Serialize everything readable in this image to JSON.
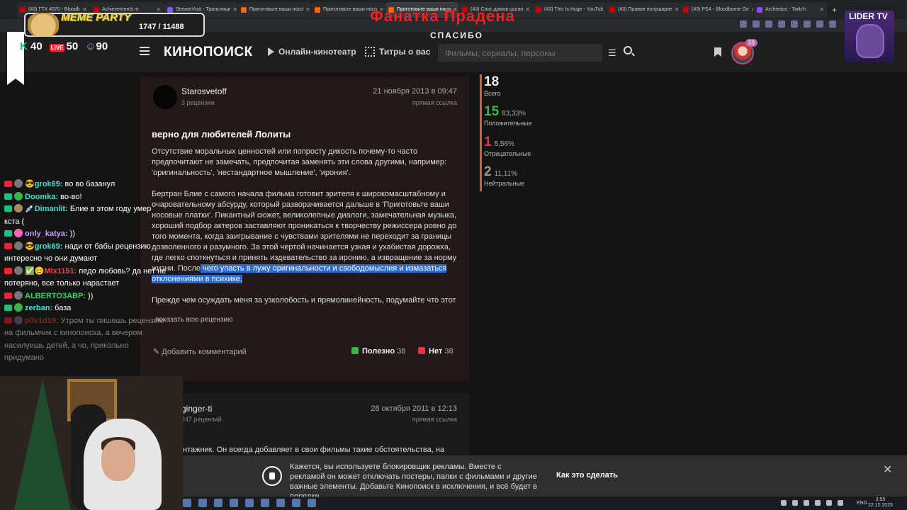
{
  "browser": {
    "tabs": [
      {
        "label": "(43) ГТХ 4070 - Bloodb"
      },
      {
        "label": "Achievements m"
      },
      {
        "label": "StreamVuio - Трансляци"
      },
      {
        "label": "Приготовьте ваши носо"
      },
      {
        "label": "Приготовьте ваши носо"
      },
      {
        "label": "Приготовьте ваши носо"
      },
      {
        "label": "(43) Снос домов цыган"
      },
      {
        "label": "(43) This Is Huge - YouTub"
      },
      {
        "label": "(43) Правое полушарие"
      },
      {
        "label": "(43) PS4 - Bloodborne Ge"
      },
      {
        "label": "Archiedos - Twitch"
      }
    ],
    "new_tab": "+"
  },
  "overlay": {
    "title": "Фанатка Прадена",
    "subtitle": "СПАСИБО",
    "meme_title": "MEME PARTY",
    "meme_count": "1747 / 11488",
    "stat_k": "40",
    "stat_live": "50",
    "stat_viewers": "90",
    "lider_label": "LIDER TV"
  },
  "header": {
    "logo": "КИНОПОИСК",
    "nav_online": "Онлайн-кинотеатр",
    "nav_titles": "Титры о вас",
    "search_placeholder": "Фильмы, сериалы, персоны",
    "avatar_badge": "59"
  },
  "review": {
    "author": "Starosvetoff",
    "author_reviews": "3 рецензии",
    "date": "21 ноября 2013 в 09:47",
    "link": "прямая ссылка",
    "title": "верно для любителей Лолиты",
    "p1": "Отсутствие моральных ценностей или попросту дикость почему-то часто предпочитают не замечать, предпочитая заменять эти слова другими, например: 'оригинальность', 'нестандартное мышление', 'ирония'.",
    "p2_plain": "Бертран Блие с самого начала фильма готовит зрителя к широкомасштабному и очаровательному абсурду, который разворачивается дальше в 'Приготовьте ваши носовые платки'. Пикантный сюжет, великолепные диалоги, замечательная музыка, хороший подбор актеров заставляют проникаться к творчеству режиссера ровно до того момента, когда заигрывание с чувствами зрителями не переходит за границы дозволенного и разумного. За этой чертой начинается узкая и ухабистая дорожка, где легко споткнуться и принять издевательство за иронию, а извращение за норму жизни. После",
    "p2_highlight": " чего упасть в лужу оригинальности и свободомыслия и измазаться отклонениями в психике.",
    "p3": "Прежде чем осуждать меня за узколобость и прямолинейность, подумайте что этот",
    "show_all": "показать всю рецензию",
    "add_comment": "Добавить комментарий",
    "useful_label": "Полезно",
    "useful_count": "38",
    "no_label": "Нет",
    "no_count": "38"
  },
  "review2": {
    "author": "ginger-ti",
    "author_reviews": "247 рецензий",
    "date": "28 октября 2011 в 12:13",
    "link": "прямая ссылка",
    "text": "нтажник. Он всегда добавляет в свои фильмы такие обстоятельства, на"
  },
  "stats": {
    "total": "18",
    "total_label": "Всего",
    "positive": "15",
    "positive_pct": "83,33%",
    "positive_label": "Положительные",
    "negative": "1",
    "negative_pct": "5,56%",
    "negative_label": "Отрицательные",
    "neutral": "2",
    "neutral_pct": "11,11%",
    "neutral_label": "Нейтральные"
  },
  "chat": [
    {
      "user": "😎grok69:",
      "msg": " во во базанул"
    },
    {
      "user": "Doomka:",
      "msg": " во-во!"
    },
    {
      "user": "💉Dimanlit:",
      "msg": " Блие в этом году умер кста ("
    },
    {
      "user": "only_katya:",
      "msg": " ))"
    },
    {
      "user": "😎grok69:",
      "msg": " нади от бабы рецензию интересно чо они думают"
    },
    {
      "user": "✅😊Mix1151:",
      "msg": " педо любовь? да нет не потеряно, все только нарастает"
    },
    {
      "user": "ALBERTO3ABP:",
      "msg": " ))"
    },
    {
      "user": "zerban:",
      "msg": " база"
    },
    {
      "user": "p0v1d19:",
      "msg": " Утром ты пишешь рецензию на фильмчик с кинопоиска, а вечером насилуешь детей, а чо, прикольно придумано"
    }
  ],
  "adblock": {
    "text": "Кажется, вы используете блокировщик рекламы. Вместе с рекламой он может отключать постеры, папки с фильмами и другие важные элементы. Добавьте Кинопоиск в исключения, и всё будет в порядке.",
    "how": "Как это сделать",
    "close": "✕"
  },
  "taskbar": {
    "lang": "ENG",
    "time": "3:55",
    "date": "22.12.2025"
  }
}
